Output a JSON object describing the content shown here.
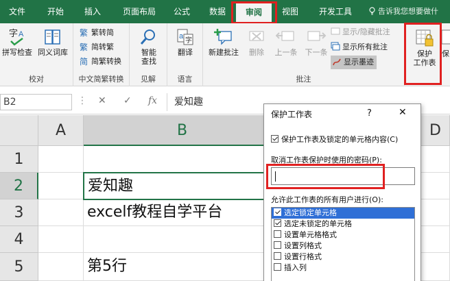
{
  "ribbon_tabs": [
    "文件",
    "开始",
    "插入",
    "页面布局",
    "公式",
    "数据",
    "审阅",
    "视图",
    "开发工具"
  ],
  "active_tab": "审阅",
  "tell_me": "告诉我您想要做什",
  "groups": {
    "proofing": {
      "label": "校对",
      "spell": "拼写检查",
      "thesaurus": "同义词库"
    },
    "chinese": {
      "label": "中文简繁转换",
      "t2s": "繁转简",
      "s2t": "简转繁",
      "convert": "简繁转换"
    },
    "insights": {
      "label": "见解",
      "smart_lookup_1": "智能",
      "smart_lookup_2": "查找"
    },
    "language": {
      "label": "语言",
      "translate": "翻译"
    },
    "comments": {
      "label": "批注",
      "new": "新建批注",
      "delete": "删除",
      "prev": "上一条",
      "next": "下一条",
      "show_hide": "显示/隐藏批注",
      "show_all": "显示所有批注",
      "show_ink": "显示墨迹"
    },
    "protect": {
      "sheet_1": "保护",
      "sheet_2": "工作表",
      "workbook_partial": "保"
    }
  },
  "formula_bar": {
    "name_box": "B2",
    "cancel": "✕",
    "enter": "✓",
    "fx": "fx",
    "content": "爱知趣"
  },
  "columns": [
    "A",
    "B",
    "D"
  ],
  "rows": [
    "1",
    "2",
    "3",
    "4",
    "5"
  ],
  "cells": {
    "B2": "爱知趣",
    "B3": "excelf教程自学平台",
    "B5": "第5行"
  },
  "dialog": {
    "title": "保护工作表",
    "help": "?",
    "close": "✕",
    "protect_contents": "保护工作表及锁定的单元格内容(C)",
    "password_label": "取消工作表保护时使用的密码(P):",
    "password_value": "",
    "allow_label": "允许此工作表的所有用户进行(O):",
    "permissions": [
      {
        "label": "选定锁定单元格",
        "checked": true
      },
      {
        "label": "选定未锁定的单元格",
        "checked": true
      },
      {
        "label": "设置单元格格式",
        "checked": false
      },
      {
        "label": "设置列格式",
        "checked": false
      },
      {
        "label": "设置行格式",
        "checked": false
      },
      {
        "label": "插入列",
        "checked": false
      }
    ]
  },
  "colors": {
    "excel_green": "#217346",
    "highlight_red": "#e02020",
    "selection_blue": "#2f6fd6"
  }
}
